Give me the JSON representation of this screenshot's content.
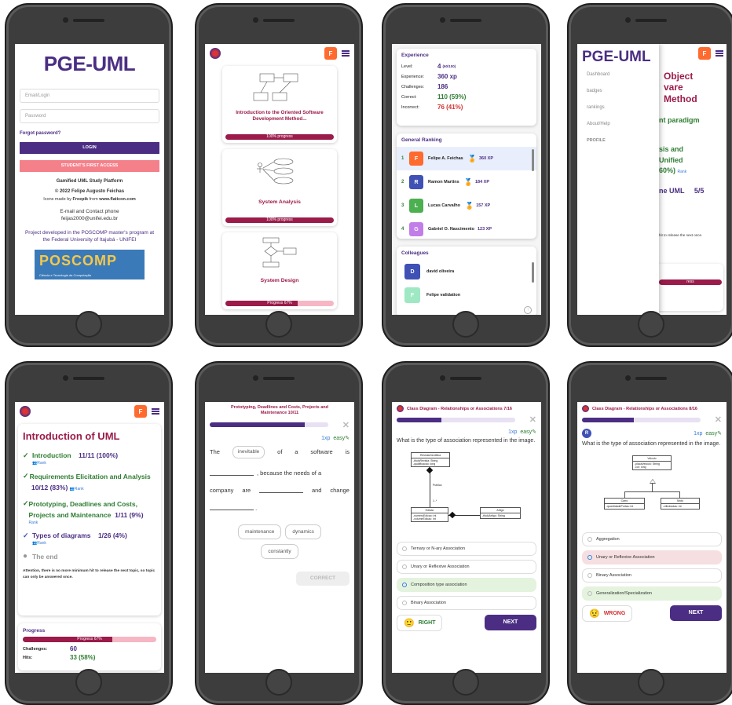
{
  "s1": {
    "logo": "PGE-UML",
    "email_placeholder": "Email/Login",
    "password_placeholder": "Password",
    "forgot": "Forgot password?",
    "login": "LOGIN",
    "first_access": "STUDENT'S FIRST ACCESS",
    "platform": "Gamified UML Study Platform",
    "copyright": "© 2022 Felipe Augusto Feichas",
    "icons_prefix": "Icons made by",
    "icons_author": "Freepik",
    "icons_from": "from",
    "icons_site": "www.flaticon.com",
    "contact_title": "E-mail and Contact phone",
    "contact_email": "feijas2000@unifei.edu.br",
    "project": "Project developed in the POSCOMP master's program at the Federal University of Itajubá - UNIFEI",
    "poscomp": "POSCOMP",
    "poscomp_sub": "Ciência e Tecnologia da Computação"
  },
  "s2": {
    "avatar": "F",
    "cards": [
      {
        "title": "Introduction to the Oriented Software Development Method...",
        "progress": "100% progress",
        "percent": 100
      },
      {
        "title": "System Analysis",
        "progress": "100% progress",
        "percent": 100
      },
      {
        "title": "System Design",
        "progress": "Progress 67%",
        "percent": 67
      }
    ]
  },
  "s3": {
    "exp_title": "Experience",
    "level_label": "Level:",
    "level_value": "4",
    "level_sub": "(60/100)",
    "experience_label": "Experience:",
    "experience_value": "360 xp",
    "challenges_label": "Challenges:",
    "challenges_value": "186",
    "correct_label": "Correct:",
    "correct_value": "110 (59%)",
    "incorrect_label": "Incorrect:",
    "incorrect_value": "76 (41%)",
    "ranking_title": "General Ranking",
    "ranking": [
      {
        "pos": "1",
        "initial": "F",
        "name": "Felipe A. Feichas",
        "xp": "360 XP",
        "color": "#ff6a2e"
      },
      {
        "pos": "2",
        "initial": "R",
        "name": "Ramon Martins",
        "xp": "184 XP",
        "color": "#3f51b5"
      },
      {
        "pos": "3",
        "initial": "L",
        "name": "Lucas Carvalho",
        "xp": "157 XP",
        "color": "#4caf50"
      },
      {
        "pos": "4",
        "initial": "G",
        "name": "Gabriel O. Nascimento",
        "xp": "123 XP",
        "color": "#c27ee8"
      }
    ],
    "colleagues_title": "Colleagues",
    "colleagues": [
      {
        "initial": "D",
        "name": "david oliveira",
        "color": "#3f51b5"
      },
      {
        "initial": "F",
        "name": "Felipe validation",
        "color": "#9fe8c4"
      }
    ]
  },
  "s4": {
    "logo": "PGE-UML",
    "avatar": "F",
    "menu": [
      "Dashboard",
      "badges",
      "rankings",
      "About/Help",
      "PROFILE"
    ],
    "bg_title_1": "Object",
    "bg_title_2": "vare",
    "bg_title_3": "Method",
    "bg_line1": "nt paradigm",
    "bg_line2": "sis and",
    "bg_line3": "Unified",
    "bg_line4": "60%)",
    "bg_rank": "Rank",
    "bg_line5": "ne UML",
    "bg_line5b": "5/5",
    "bg_note": "hit to release the next once.",
    "bg_progress": "ress"
  },
  "s5": {
    "avatar": "F",
    "title": "Introduction of UML",
    "topics": [
      {
        "name": "Introduction",
        "score": "11/11 (100%)",
        "rank": "Rank",
        "done": true
      },
      {
        "name": "Requirements Elicitation and Analysis",
        "score": "10/12 (83%)",
        "rank": "Rank",
        "done": true
      },
      {
        "name": "Prototyping, Deadlines and Costs, Projects and Maintenance",
        "score": "1/11 (9%)",
        "rank": "Rank",
        "done": true
      },
      {
        "name": "Types of diagrams",
        "score": "1/26 (4%)",
        "rank": "Rank",
        "done": true
      }
    ],
    "end": "The end",
    "note": "Attention, there is no more minimum hit to release the next topic, so topic can only be answered once.",
    "progress_title": "Progress",
    "progress_label": "Progress 67%",
    "progress_percent": 67,
    "challenges_label": "Challenges:",
    "challenges_value": "60",
    "hits_label": "Hits:",
    "hits_value": "33 (58%)"
  },
  "s6": {
    "title": "Prototyping, Deadlines and Costs, Projects and Maintenance 10/11",
    "xp": "1xp",
    "difficulty": "easy",
    "w_the": "The",
    "chip_filled": "inevitable",
    "w_of": "of",
    "w_a": "a",
    "w_software": "software",
    "w_is": "is",
    "w_because": ", because the needs of a",
    "w_company": "company",
    "w_are": "are",
    "w_and": "and",
    "w_change": "change",
    "options": [
      "maintenance",
      "dynamics",
      "constantly"
    ],
    "correct": "CORRECT",
    "progress_percent": 91
  },
  "s7": {
    "title": "Class Diagram - Relationships or Associations 7/16",
    "xp": "1xp",
    "difficulty": "easy",
    "question": "What is the type of association represented in the image.",
    "uml": {
      "top_name": "RevistaCientifica",
      "top_attrs": "-tituloRevista: String\n-qualificacao: long",
      "role": "Publica",
      "mult": "1..*",
      "left_name": "Edicao",
      "left_attrs": "-numeroEdicao: int\n-volumeEdicao: int",
      "right_name": "Artigo",
      "right_attrs": "-tituloArtigo: String"
    },
    "options": [
      "Ternary or N-ary Association",
      "Unary or Reflexive Association",
      "Composition type association",
      "Binary Association"
    ],
    "selected": 2,
    "result": "RIGHT",
    "next": "NEXT",
    "progress_percent": 44
  },
  "s8": {
    "title": "Class Diagram - Relationships or Associations 8/16",
    "avatar": "R",
    "xp": "1xp",
    "difficulty": "easy",
    "question": "What is the type of association represented in the image.",
    "uml": {
      "top_name": "Veiculo",
      "top_attrs": "-placaVeiculo: String\n-cor: long",
      "left_name": "Carro",
      "left_attrs": "-quantidadePortas: int",
      "right_name": "Moto",
      "right_attrs": "-cilindradas: int"
    },
    "options": [
      "Aggregation",
      "Unary or Reflexive Association",
      "Binary Association",
      "Generalization/Specialization"
    ],
    "selected": 1,
    "result": "WRONG",
    "next": "NEXT",
    "progress_percent": 50
  }
}
